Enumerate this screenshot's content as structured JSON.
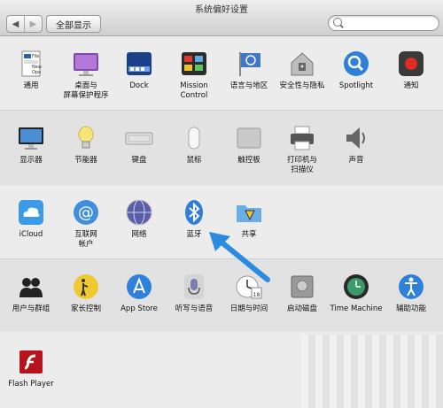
{
  "window": {
    "title": "系统偏好设置"
  },
  "toolbar": {
    "back": "◀",
    "forward": "▶",
    "show_all": "全部显示",
    "search_placeholder": ""
  },
  "rows": [
    [
      {
        "id": "general",
        "label": "通用"
      },
      {
        "id": "desktop",
        "label": "桌面与\n屏幕保护程序"
      },
      {
        "id": "dock",
        "label": "Dock"
      },
      {
        "id": "mission-control",
        "label": "Mission\nControl"
      },
      {
        "id": "language",
        "label": "语言与地区"
      },
      {
        "id": "security",
        "label": "安全性与隐私"
      },
      {
        "id": "spotlight",
        "label": "Spotlight"
      },
      {
        "id": "notifications",
        "label": "通知"
      }
    ],
    [
      {
        "id": "displays",
        "label": "显示器"
      },
      {
        "id": "energy",
        "label": "节能器"
      },
      {
        "id": "keyboard",
        "label": "键盘"
      },
      {
        "id": "mouse",
        "label": "鼠标"
      },
      {
        "id": "trackpad",
        "label": "触控板"
      },
      {
        "id": "printers",
        "label": "打印机与\n扫描仪"
      },
      {
        "id": "sound",
        "label": "声音"
      }
    ],
    [
      {
        "id": "icloud",
        "label": "iCloud"
      },
      {
        "id": "internet-accounts",
        "label": "互联网\n帐户"
      },
      {
        "id": "network",
        "label": "网络"
      },
      {
        "id": "bluetooth",
        "label": "蓝牙"
      },
      {
        "id": "sharing",
        "label": "共享"
      }
    ],
    [
      {
        "id": "users",
        "label": "用户与群组"
      },
      {
        "id": "parental",
        "label": "家长控制"
      },
      {
        "id": "appstore",
        "label": "App Store"
      },
      {
        "id": "dictation",
        "label": "听写与语音"
      },
      {
        "id": "datetime",
        "label": "日期与时间"
      },
      {
        "id": "startup",
        "label": "启动磁盘"
      },
      {
        "id": "timemachine",
        "label": "Time Machine"
      },
      {
        "id": "accessibility",
        "label": "辅助功能"
      }
    ],
    [
      {
        "id": "flash",
        "label": "Flash Player"
      }
    ]
  ],
  "colors": {
    "accent": "#2a7fd6",
    "arrow": "#2a8be0"
  }
}
